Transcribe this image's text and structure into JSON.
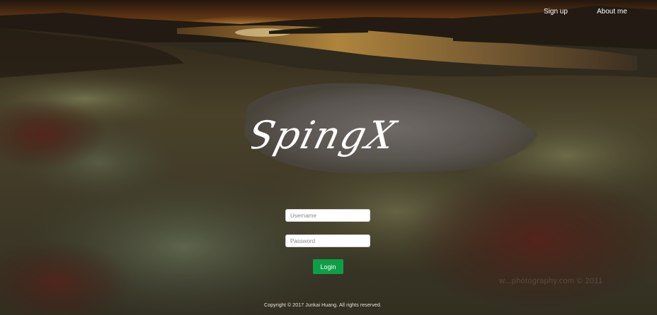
{
  "nav": {
    "signup": "Sign up",
    "about": "About me"
  },
  "logo": {
    "text": "SpingX"
  },
  "login_form": {
    "username_placeholder": "Username",
    "password_placeholder": "Password",
    "login_label": "Login"
  },
  "footer": {
    "copyright": "Copyright © 2017 Junkai Huang. All rights reserved."
  },
  "watermark": "w...photography.com © 2011",
  "colors": {
    "login_button": "#0e9f46",
    "nav_text": "#ffffff",
    "input_bg": "#ffffff"
  }
}
